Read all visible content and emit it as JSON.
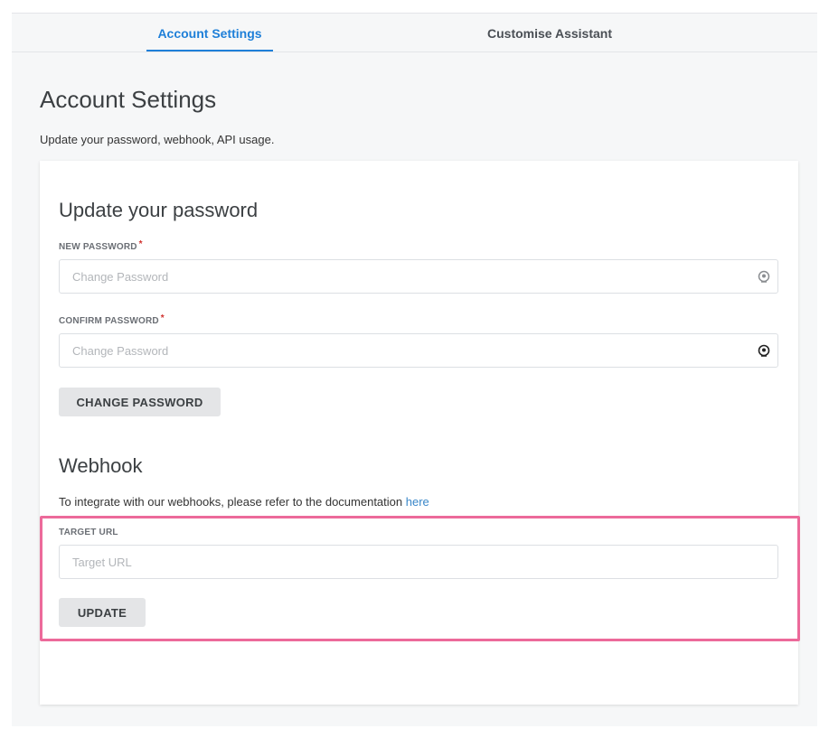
{
  "tabs": {
    "account": "Account Settings",
    "assistant": "Customise Assistant",
    "active_color": "#1e7fd8"
  },
  "page": {
    "title": "Account Settings",
    "subtitle": "Update your password, webhook, API usage."
  },
  "password_section": {
    "title": "Update your password",
    "new_password_label": "NEW PASSWORD",
    "new_password_placeholder": "Change Password",
    "confirm_password_label": "CONFIRM PASSWORD",
    "confirm_password_placeholder": "Change Password",
    "required_mark": "*",
    "button_label": "CHANGE PASSWORD",
    "icon": "eye-icon"
  },
  "webhook_section": {
    "title": "Webhook",
    "doc_text": "To integrate with our webhooks, please refer to the documentation ",
    "doc_link": "here",
    "target_url_label": "TARGET URL",
    "target_url_placeholder": "Target URL",
    "button_label": "UPDATE",
    "highlight_color": "#ec6a9a"
  }
}
